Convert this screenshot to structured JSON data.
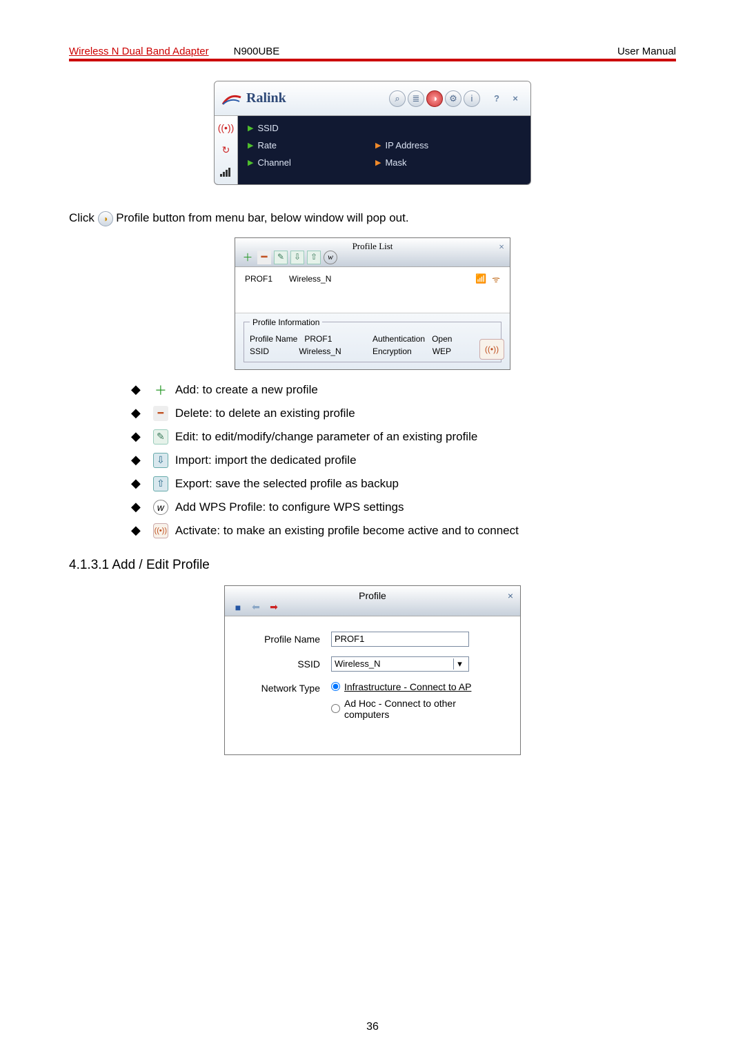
{
  "header": {
    "product": "Wireless N Dual Band Adapter",
    "model": "N900UBE",
    "doc_type": "User Manual"
  },
  "ralink": {
    "brand": "Ralink",
    "fields": {
      "ssid_label": "SSID",
      "rate_label": "Rate",
      "channel_label": "Channel",
      "ip_label": "IP Address",
      "mask_label": "Mask"
    },
    "title_icons": {
      "search": "⌕",
      "list": "≣",
      "profile": "◑",
      "advanced": "⚙",
      "info": "i",
      "help": "?",
      "close": "×"
    }
  },
  "instruction_text_1": "Click ",
  "instruction_text_2": " Profile button from menu bar, below window will pop out.",
  "profile_list": {
    "title": "Profile List",
    "close": "×",
    "row": {
      "name": "PROF1",
      "ssid": "Wireless_N"
    },
    "info_legend": "Profile Information",
    "info": {
      "pn_label": "Profile Name",
      "pn": "PROF1",
      "ssid_label": "SSID",
      "ssid": "Wireless_N",
      "auth_label": "Authentication",
      "auth": "Open",
      "enc_label": "Encryption",
      "enc": "WEP"
    }
  },
  "bullets": {
    "add": "Add: to create a new profile",
    "del": "Delete: to delete an existing profile",
    "edit": "Edit: to edit/modify/change parameter of an existing profile",
    "imp": "Import: import the dedicated profile",
    "exp": "Export: save the selected profile as backup",
    "wps": "Add WPS Profile: to configure WPS settings",
    "act": "Activate: to make an existing profile become active and to connect"
  },
  "section_heading": "4.1.3.1 Add / Edit Profile",
  "edit": {
    "title": "Profile",
    "close": "×",
    "pn_label": "Profile Name",
    "pn_value": "PROF1",
    "ssid_label": "SSID",
    "ssid_value": "Wireless_N",
    "nt_label": "Network Type",
    "nt_opt1": "Infrastructure - Connect to AP",
    "nt_opt2": "Ad Hoc - Connect to other computers"
  },
  "page_number": "36"
}
